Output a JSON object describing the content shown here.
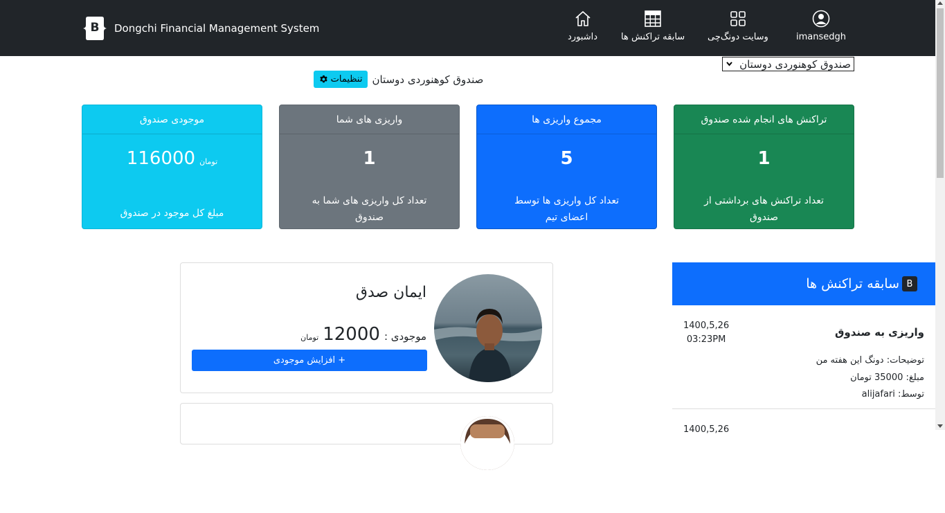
{
  "nav": {
    "brand_letter": "B",
    "brand_title": "Dongchi Financial Management System",
    "items": [
      {
        "label": "imansedgh",
        "icon": "user-circle-icon"
      },
      {
        "label": "وسایت دونگ‌چی",
        "icon": "grid-icon"
      },
      {
        "label": "سابقه تراکنش ها",
        "icon": "table-icon"
      },
      {
        "label": "داشبورد",
        "icon": "home-icon"
      }
    ]
  },
  "fund_selector": {
    "selected": "صندوق کوهنوردی دوستان"
  },
  "fund_title": {
    "name": "صندوق کوهنوردی دوستان",
    "settings_label": "تنظیمات"
  },
  "cards": [
    {
      "header": "موجودی صندوق",
      "value": "116000",
      "unit": "تومان",
      "text": "مبلغ کل موجود در صندوق",
      "color": "#0dcaf0"
    },
    {
      "header": "واریزی های شما",
      "value": "1",
      "text": "تعداد کل واریزی های شما به صندوق",
      "color": "#6c757d"
    },
    {
      "header": "مجموع واریزی ها",
      "value": "5",
      "text": "تعداد کل واریزی ها توسط اعضای تیم",
      "color": "#0d6efd"
    },
    {
      "header": "تراکنش های انجام شده صندوق",
      "value": "1",
      "text": "تعداد تراکنش های برداشتی از صندوق",
      "color": "#198754"
    }
  ],
  "member": {
    "name": "ایمان صدق",
    "balance_label": "موجودی :",
    "balance": "12000",
    "unit": "تومان",
    "add_button": "+ افزایش موجودی"
  },
  "history": {
    "title": "سابقه تراکنش ها",
    "badge": "B",
    "items": [
      {
        "date": "1400,5,26",
        "time": "03:23PM",
        "title": "واریزی به صندوق",
        "description": "توضیحات: دونگ این هفته من",
        "amount": "مبلغ: 35000 تومان",
        "by": "توسط: alijafari"
      },
      {
        "date": "1400,5,26"
      }
    ]
  },
  "colors": {
    "navbar": "#212529",
    "primary": "#0d6efd",
    "info": "#0dcaf0",
    "secondary": "#6c757d",
    "success": "#198754"
  }
}
